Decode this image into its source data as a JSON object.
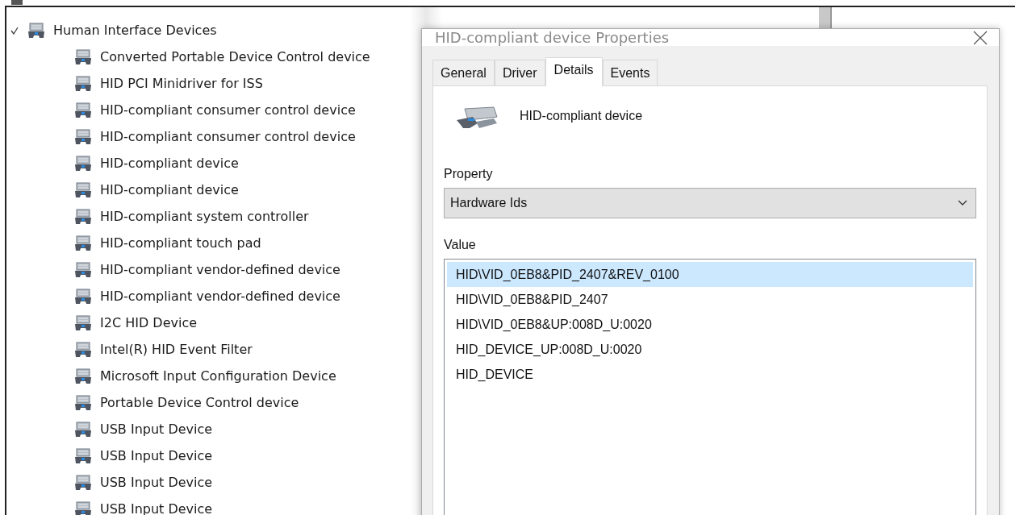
{
  "tree": {
    "label": "Human Interface Devices",
    "expanded": true,
    "children": [
      {
        "label": "Converted Portable Device Control device"
      },
      {
        "label": "HID PCI Minidriver for ISS"
      },
      {
        "label": "HID-compliant consumer control device"
      },
      {
        "label": "HID-compliant consumer control device"
      },
      {
        "label": "HID-compliant device"
      },
      {
        "label": "HID-compliant device"
      },
      {
        "label": "HID-compliant system controller"
      },
      {
        "label": "HID-compliant touch pad"
      },
      {
        "label": "HID-compliant vendor-defined device"
      },
      {
        "label": "HID-compliant vendor-defined device"
      },
      {
        "label": "I2C HID Device"
      },
      {
        "label": "Intel(R) HID Event Filter"
      },
      {
        "label": "Microsoft Input Configuration Device"
      },
      {
        "label": "Portable Device Control device"
      },
      {
        "label": "USB Input Device"
      },
      {
        "label": "USB Input Device"
      },
      {
        "label": "USB Input Device"
      },
      {
        "label": "USB Input Device"
      }
    ]
  },
  "dialog": {
    "title": "HID-compliant device Properties",
    "tabs": [
      {
        "label": "General",
        "selected": false
      },
      {
        "label": "Driver",
        "selected": false
      },
      {
        "label": "Details",
        "selected": true
      },
      {
        "label": "Events",
        "selected": false
      }
    ],
    "device_name": "HID-compliant device",
    "property_label": "Property",
    "property_value": "Hardware Ids",
    "value_label": "Value",
    "values": [
      {
        "text": "HID\\VID_0EB8&PID_2407&REV_0100",
        "selected": true
      },
      {
        "text": "HID\\VID_0EB8&PID_2407",
        "selected": false
      },
      {
        "text": "HID\\VID_0EB8&UP:008D_U:0020",
        "selected": false
      },
      {
        "text": "HID_DEVICE_UP:008D_U:0020",
        "selected": false
      },
      {
        "text": "HID_DEVICE",
        "selected": false
      }
    ]
  }
}
